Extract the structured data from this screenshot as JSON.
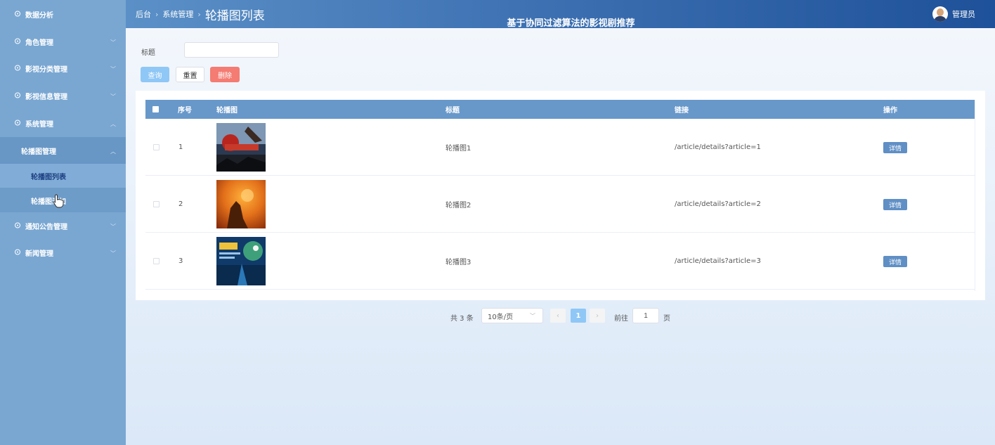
{
  "sidebar": {
    "items": [
      {
        "label": "数据分析"
      },
      {
        "label": "角色管理"
      },
      {
        "label": "影视分类管理"
      },
      {
        "label": "影视信息管理"
      },
      {
        "label": "系统管理"
      },
      {
        "label": "通知公告管理"
      },
      {
        "label": "新闻管理"
      }
    ],
    "submenu": {
      "label": "轮播图管理",
      "children": [
        {
          "label": "轮播图列表"
        },
        {
          "label": "轮播图添加"
        }
      ]
    }
  },
  "header": {
    "breadcrumb": [
      "后台",
      "系统管理",
      "轮播图列表"
    ],
    "system_title": "基于协同过滤算法的影视剧推荐",
    "user_name": "管理员"
  },
  "search": {
    "label": "标题",
    "value": ""
  },
  "buttons": {
    "query": "查询",
    "reset": "重置",
    "delete": "删除"
  },
  "table": {
    "columns": [
      "序号",
      "轮播图",
      "标题",
      "链接",
      "操作"
    ],
    "rows": [
      {
        "index": "1",
        "title": "轮播图1",
        "link": "/article/details?article=1",
        "action": "详情"
      },
      {
        "index": "2",
        "title": "轮播图2",
        "link": "/article/details?article=2",
        "action": "详情"
      },
      {
        "index": "3",
        "title": "轮播图3",
        "link": "/article/details?article=3",
        "action": "详情"
      }
    ]
  },
  "pagination": {
    "total": "共 3 条",
    "page_size": "10条/页",
    "current_page": "1",
    "goto_label": "前往",
    "goto_value": "1",
    "page_suffix": "页"
  },
  "colors": {
    "sidebar_bg": "#7aa7d2",
    "header_start": "#5b90c7",
    "header_end": "#1e5199",
    "table_header": "#6898ca",
    "delete_button": "#f47c72",
    "query_button": "#8fc7f6"
  }
}
